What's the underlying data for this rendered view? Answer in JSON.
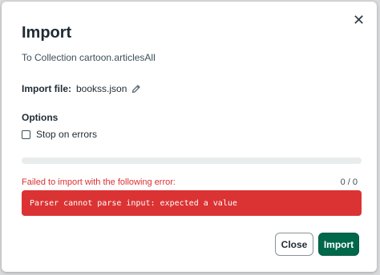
{
  "dialog": {
    "title": "Import",
    "subtitle": "To Collection cartoon.articlesAll",
    "close_icon": "close-icon"
  },
  "file": {
    "label": "Import file:",
    "name": "bookss.json",
    "edit_icon": "pencil-icon"
  },
  "options": {
    "title": "Options",
    "stop_on_errors_label": "Stop on errors",
    "stop_on_errors_checked": false
  },
  "progress": {
    "fraction": 0
  },
  "error": {
    "message": "Failed to import with the following error:",
    "counter": "0 / 0",
    "detail": "Parser cannot parse input: expected a value"
  },
  "buttons": {
    "close_label": "Close",
    "import_label": "Import"
  },
  "colors": {
    "accent": "#00684a",
    "error": "#db3333",
    "error_text": "#db3030"
  }
}
